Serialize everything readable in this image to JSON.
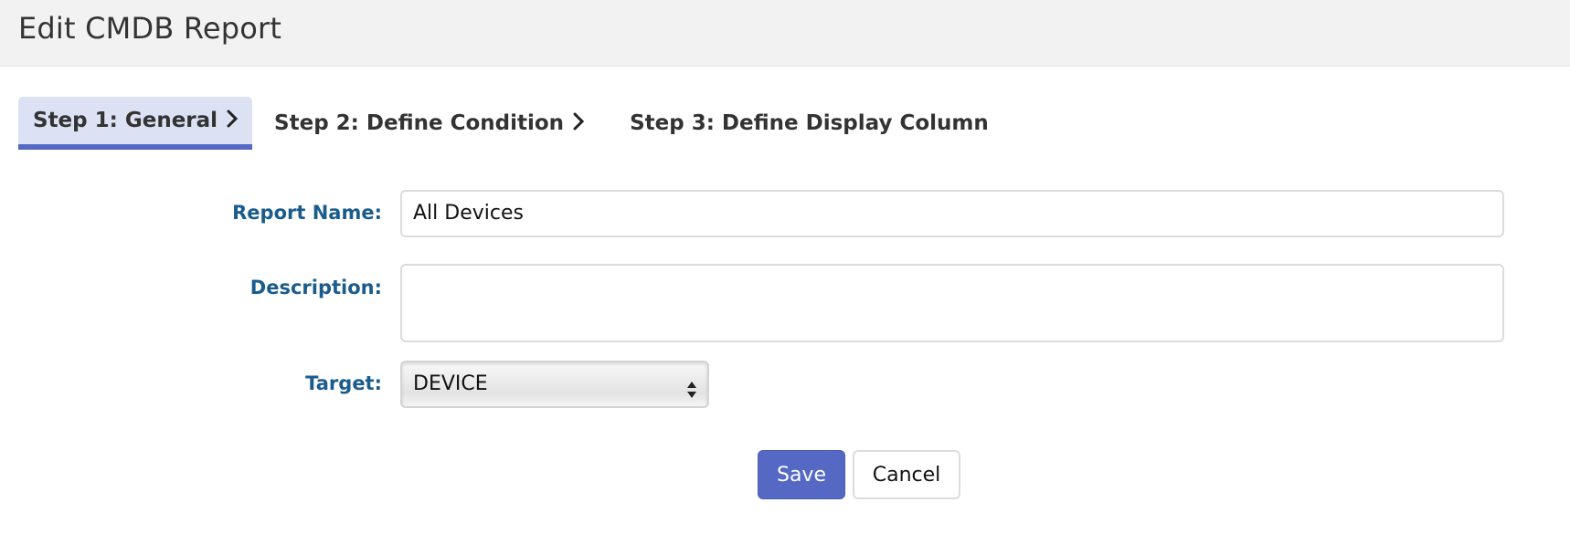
{
  "header": {
    "title": "Edit CMDB Report"
  },
  "steps": [
    {
      "label": "Step 1: General",
      "active": true
    },
    {
      "label": "Step 2: Define Condition",
      "active": false
    },
    {
      "label": "Step 3: Define Display Column",
      "active": false
    }
  ],
  "form": {
    "report_name": {
      "label": "Report Name:",
      "value": "All Devices"
    },
    "description": {
      "label": "Description:",
      "value": ""
    },
    "target": {
      "label": "Target:",
      "selected": "DEVICE"
    }
  },
  "buttons": {
    "save_label": "Save",
    "cancel_label": "Cancel"
  },
  "colors": {
    "accent": "#5468c4",
    "label": "#1a5c8c",
    "active_step_bg": "#dde1f4",
    "header_bg": "#f2f2f2"
  }
}
